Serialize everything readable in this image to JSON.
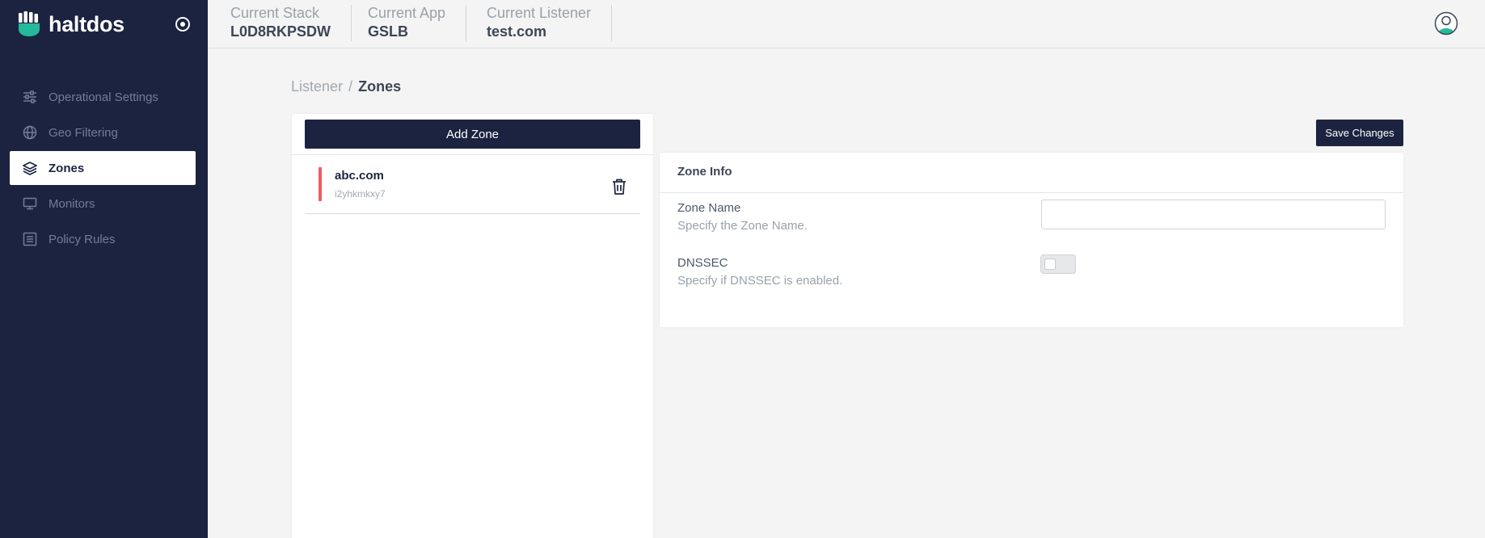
{
  "brand": {
    "name": "haltdos",
    "logo_icon": "fist-logo-icon",
    "accent": "#24b99a"
  },
  "sidebar": {
    "settings_icon": "target-icon",
    "items": [
      {
        "label": "Operational Settings",
        "icon": "sliders-icon",
        "active": false
      },
      {
        "label": "Geo Filtering",
        "icon": "globe-icon",
        "active": false
      },
      {
        "label": "Zones",
        "icon": "layers-icon",
        "active": true
      },
      {
        "label": "Monitors",
        "icon": "monitor-icon",
        "active": false
      },
      {
        "label": "Policy Rules",
        "icon": "list-icon",
        "active": false
      }
    ]
  },
  "topbar": {
    "stack": {
      "label": "Current Stack",
      "value": "L0D8RKPSDW"
    },
    "app": {
      "label": "Current App",
      "value": "GSLB"
    },
    "listener": {
      "label": "Current Listener",
      "value": "test.com"
    },
    "avatar_icon": "user-avatar-icon"
  },
  "breadcrumb": {
    "parent": "Listener",
    "separator": "/",
    "current": "Zones"
  },
  "zones": {
    "add_label": "Add Zone",
    "items": [
      {
        "name": "abc.com",
        "id": "i2yhkmkxy7",
        "status_color": "#ee5b63"
      }
    ]
  },
  "actions": {
    "save_label": "Save Changes"
  },
  "zone_info": {
    "title": "Zone Info",
    "zone_name": {
      "label": "Zone Name",
      "help": "Specify the Zone Name.",
      "value": "",
      "placeholder": ""
    },
    "dnssec": {
      "label": "DNSSEC",
      "help": "Specify if DNSSEC is enabled.",
      "enabled": false
    }
  },
  "colors": {
    "sidebar_bg": "#1c2340",
    "page_bg": "#f3f4f3",
    "danger": "#ee5b63"
  }
}
